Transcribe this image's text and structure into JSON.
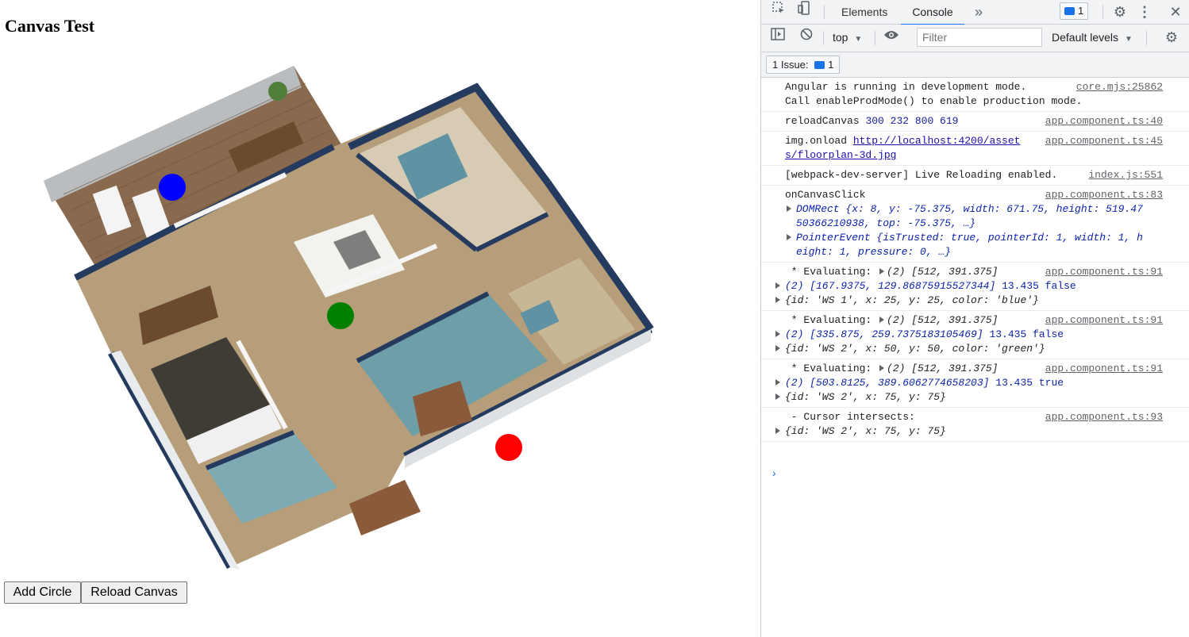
{
  "page": {
    "title": "Canvas Test",
    "buttons": {
      "add_circle": "Add Circle",
      "reload_canvas": "Reload Canvas"
    },
    "circles": [
      {
        "color": "#0000ff"
      },
      {
        "color": "#008000"
      },
      {
        "color": "#ff0000"
      }
    ]
  },
  "devtools": {
    "tabs": {
      "elements": "Elements",
      "console": "Console",
      "more": "»"
    },
    "issues_count": "1",
    "toolbar": {
      "context": "top",
      "filter_placeholder": "Filter",
      "levels": "Default levels"
    },
    "issue_bar": {
      "label": "1 Issue:",
      "count": "1"
    },
    "icons": [
      "inspect-icon",
      "device-toggle-icon",
      "settings-icon",
      "more-vert-icon",
      "close-icon",
      "sidebar-icon",
      "clear-icon",
      "eye-icon",
      "settings-icon"
    ],
    "console": [
      {
        "text1": "Angular is running in development mode.",
        "text2": "Call enableProdMode() to enable production mode.",
        "src": "core.mjs:25862"
      },
      {
        "text": "reloadCanvas",
        "nums": "300 232 800 619",
        "src": "app.component.ts:40"
      },
      {
        "text": "img.onload",
        "url1": "http://localhost:4200/asset",
        "url2": "s/floorplan-3d.jpg",
        "src": "app.component.ts:45"
      },
      {
        "text": "[webpack-dev-server] Live Reloading enabled.",
        "src": "index.js:551"
      },
      {
        "text": "onCanvasClick",
        "src": "app.component.ts:83",
        "line2": "DOMRect {x: 8, y: -75.375, width: 671.75, height: 519.47",
        "line3": "50366210938, top: -75.375, …}",
        "line4": "PointerEvent {isTrusted: true, pointerId: 1, width: 1, h",
        "line5": "eight: 1, pressure: 0, …}"
      },
      {
        "text": " * Evaluating: ",
        "arr": "(2) [512, 391.375]",
        "src": "app.component.ts:91",
        "line2": "(2) [167.9375, 129.86875915527344]",
        "extra": "13.435 false",
        "line3": "{id: 'WS 1', x: 25, y: 25, color: 'blue'}"
      },
      {
        "text": " * Evaluating: ",
        "arr": "(2) [512, 391.375]",
        "src": "app.component.ts:91",
        "line2": "(2) [335.875, 259.7375183105469]",
        "extra": "13.435 false",
        "line3": "{id: 'WS 2', x: 50, y: 50, color: 'green'}"
      },
      {
        "text": " * Evaluating: ",
        "arr": "(2) [512, 391.375]",
        "src": "app.component.ts:91",
        "line2": "(2) [503.8125, 389.6062774658203]",
        "extra": "13.435 true",
        "line3": "{id: 'WS 2', x: 75, y: 75}"
      },
      {
        "text": " - Cursor intersects:",
        "src": "app.component.ts:93",
        "line2": "{id: 'WS 2', x: 75, y: 75}"
      }
    ],
    "prompt": "›"
  }
}
